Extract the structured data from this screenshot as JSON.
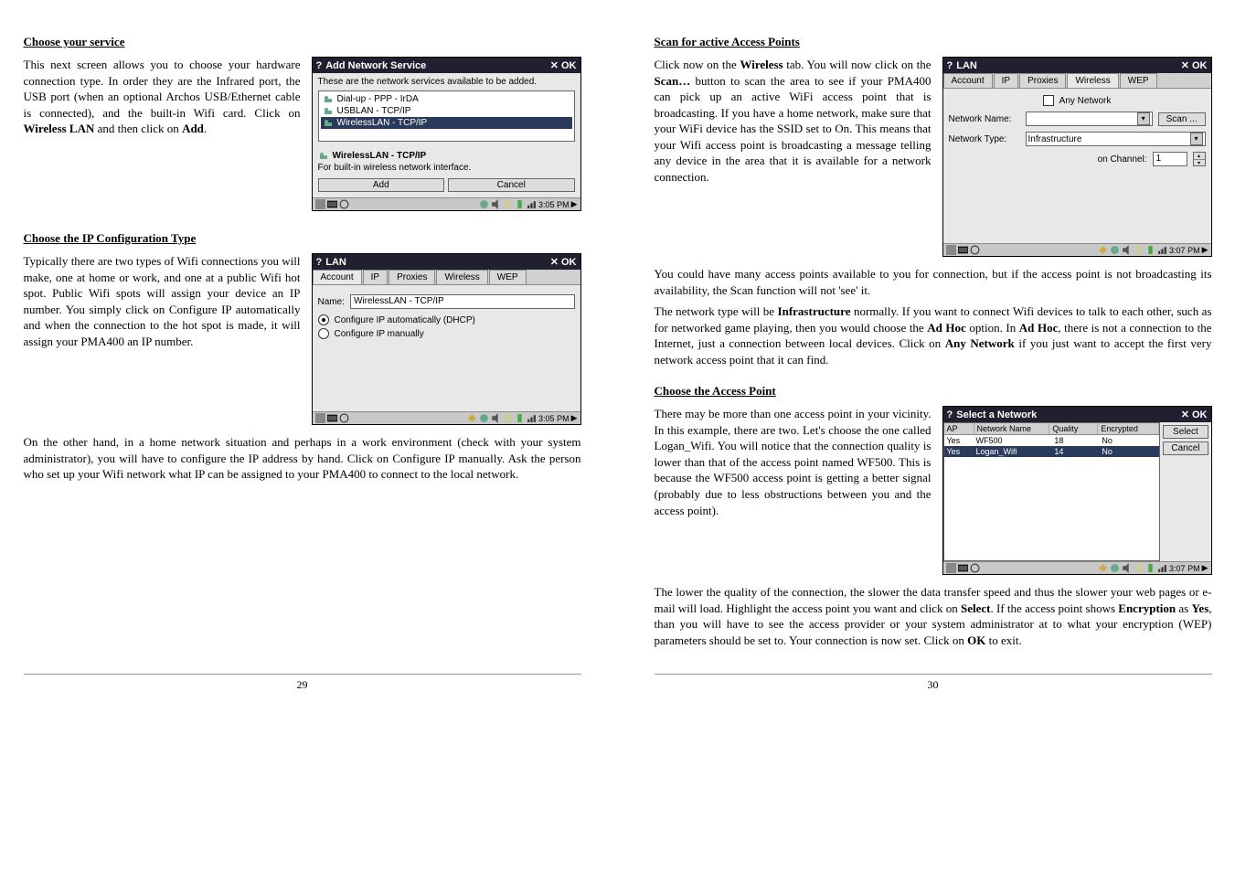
{
  "left": {
    "s1": {
      "heading": "Choose your service",
      "para": "This next screen allows you to choose your hardware connection type. In order they are the Infrared port, the USB port (when an optional Archos USB/Ethernet cable is connected), and the built-in Wifi card. Click on ",
      "bold1": "Wireless LAN",
      "mid": " and then click on ",
      "bold2": "Add",
      "end": "."
    },
    "fig1": {
      "title": "Add Network Service",
      "ok": "OK",
      "desc": "These are the network services available to be added.",
      "item1": "Dial-up - PPP - IrDA",
      "item2": "USBLAN - TCP/IP",
      "item3": "WirelessLAN - TCP/IP",
      "hint_title": "WirelessLAN - TCP/IP",
      "hint_text": "For built-in wireless network interface.",
      "btn_add": "Add",
      "btn_cancel": "Cancel",
      "time": "3:05 PM"
    },
    "s2": {
      "heading": "Choose the IP Configuration Type",
      "para": "Typically there are two types of Wifi connections you will make, one at home or work, and one at a public Wifi hot spot. Public Wifi spots will assign your device an IP number. You simply click on Configure IP automatically and when the connection to the hot spot is made, it will assign your PMA400 an IP number."
    },
    "fig2": {
      "title": "LAN",
      "ok": "OK",
      "tab1": "Account",
      "tab2": "IP",
      "tab3": "Proxies",
      "tab4": "Wireless",
      "tab5": "WEP",
      "name_label": "Name:",
      "name_value": "WirelessLAN - TCP/IP",
      "radio1": "Configure IP automatically (DHCP)",
      "radio2": "Configure IP manually",
      "time": "3:05 PM"
    },
    "s2b": "On the other hand, in a home network situation and perhaps in a work environment (check with your system administrator), you will have to configure the IP address by hand. Click on Configure IP manually. Ask the person who set up your Wifi network what IP can be assigned to your PMA400 to connect to the local network.",
    "page_num": "29"
  },
  "right": {
    "s3": {
      "heading": "Scan for active Access Points",
      "p1a": "Click now on the ",
      "p1b": "Wireless",
      "p1c": " tab. You will now click on the ",
      "p1d": "Scan…",
      "p1e": " button to scan the area to see if your PMA400 can pick up an active WiFi access point that is broadcasting. If you have a home network, make sure that your WiFi device has the SSID set to On. This means that your Wifi access point is broadcasting a message telling any device in the area that it is available for a network connection."
    },
    "fig3": {
      "title": "LAN",
      "ok": "OK",
      "tab1": "Account",
      "tab2": "IP",
      "tab3": "Proxies",
      "tab4": "Wireless",
      "tab5": "WEP",
      "any": "Any Network",
      "nn_label": "Network Name:",
      "scan_btn": "Scan ...",
      "nt_label": "Network Type:",
      "nt_value": "Infrastructure",
      "ch_label": "on Channel:",
      "ch_value": "1",
      "time": "3:07 PM"
    },
    "s3b": " You could have many access points available to you for connection, but if the access point is not broadcasting its availability, the Scan function will not 'see' it.",
    "s3c_a": "The network type will be ",
    "s3c_b": "Infrastructure",
    "s3c_c": " normally. If you want to connect Wifi devices to talk to each other, such as for networked game playing, then you would choose the ",
    "s3c_d": "Ad Hoc",
    "s3c_e": " option. In ",
    "s3c_f": "Ad Hoc",
    "s3c_g": ", there is not a connection to the Internet, just a connection between local devices. Click on ",
    "s3c_h": "Any Network",
    "s3c_i": " if you just want to accept the first very network access point that it can find.",
    "s4": {
      "heading": "Choose the Access Point",
      "para": "There may be more than one access point in your vicinity. In this example, there are two. Let's choose the one called Logan_Wifi. You will notice that the connection quality is lower than that of the access point named WF500. This is because the WF500 access point is getting a better signal (probably due to less obstructions between you and the access point)."
    },
    "fig4": {
      "title": "Select a Network",
      "ok": "OK",
      "col_ap": "AP",
      "col_nn": "Network Name",
      "col_q": "Quality",
      "col_e": "Encrypted",
      "r1_ap": "Yes",
      "r1_nn": "WF500",
      "r1_q": "18",
      "r1_e": "No",
      "r2_ap": "Yes",
      "r2_nn": "Logan_Wifi",
      "r2_q": "14",
      "r2_e": "No",
      "btn_select": "Select",
      "btn_cancel": "Cancel",
      "time": "3:07 PM"
    },
    "s4b_a": "The lower the quality of the connection, the slower the data transfer speed and thus the slower your web pages or e-mail will load. Highlight the access point you want and click on ",
    "s4b_b": "Select",
    "s4b_c": ". If the access point shows ",
    "s4b_d": "Encryption",
    "s4b_e": " as ",
    "s4b_f": "Yes",
    "s4b_g": ", than you will have to see the access provider or your system administrator at to what your encryption (WEP) parameters should be set to. Your connection is now set. Click on ",
    "s4b_h": "OK",
    "s4b_i": " to exit.",
    "page_num": "30"
  }
}
